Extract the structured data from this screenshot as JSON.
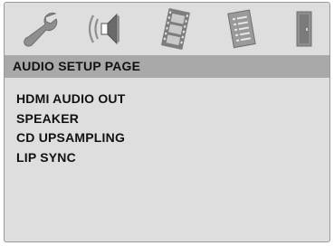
{
  "toolbar": {
    "icons": [
      {
        "name": "general-setup-wrench-icon",
        "active": false
      },
      {
        "name": "audio-setup-speaker-icon",
        "active": true
      },
      {
        "name": "video-setup-film-icon",
        "active": false
      },
      {
        "name": "preference-page-document-icon",
        "active": false
      },
      {
        "name": "exit-door-icon",
        "active": false
      }
    ]
  },
  "page": {
    "title": "AUDIO SETUP PAGE"
  },
  "menu": {
    "items": [
      "HDMI AUDIO OUT",
      "SPEAKER",
      "CD UPSAMPLING",
      "LIP SYNC"
    ]
  },
  "colors": {
    "panel_bg": "#dedede",
    "title_bar_bg": "#a9a9a9",
    "icon_gray": "#8e8e8e",
    "icon_dark": "#5f5f5f"
  }
}
